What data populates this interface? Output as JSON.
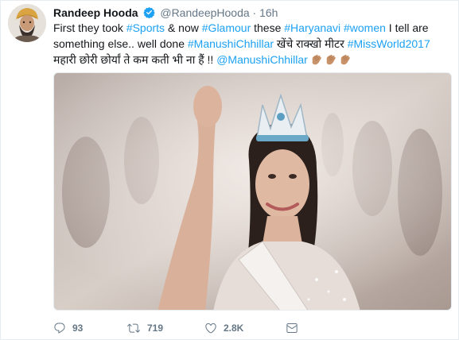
{
  "tweet": {
    "author_name": "Randeep Hooda",
    "handle": "@RandeepHooda",
    "separator": "·",
    "timestamp": "16h",
    "text": {
      "line1": [
        {
          "text": "First they took  ",
          "type": "plain"
        },
        {
          "text": "#Sports",
          "type": "hashtag"
        },
        {
          "text": " & now ",
          "type": "plain"
        },
        {
          "text": "#Glamour",
          "type": "hashtag"
        },
        {
          "text": " these ",
          "type": "plain"
        },
        {
          "text": "#Haryanavi",
          "type": "hashtag"
        },
        {
          "text": " ",
          "type": "plain"
        },
        {
          "text": "#women",
          "type": "hashtag"
        },
        {
          "text": " I tell are",
          "type": "plain"
        }
      ],
      "line2": [
        {
          "text": "something else.. well done ",
          "type": "plain"
        },
        {
          "text": "#ManushiChhillar",
          "type": "hashtag"
        },
        {
          "text": "  खेंचे राक्खो मीटर ",
          "type": "plain"
        },
        {
          "text": "#MissWorld2017",
          "type": "hashtag"
        }
      ],
      "line3": [
        {
          "text": "महारी छोरी छोर्यां ते कम कती भी ना हैं !! ",
          "type": "plain"
        },
        {
          "text": "@ManushiChhillar",
          "type": "mention"
        }
      ],
      "emoji": [
        "clapping-hands",
        "clapping-hands",
        "clapping-hands"
      ]
    },
    "actions": {
      "replies": "93",
      "retweets": "719",
      "likes": "2.8K"
    }
  },
  "colors": {
    "link": "#1da1f2",
    "muted": "#657786",
    "verified": "#1da1f2",
    "text": "#14171a"
  }
}
